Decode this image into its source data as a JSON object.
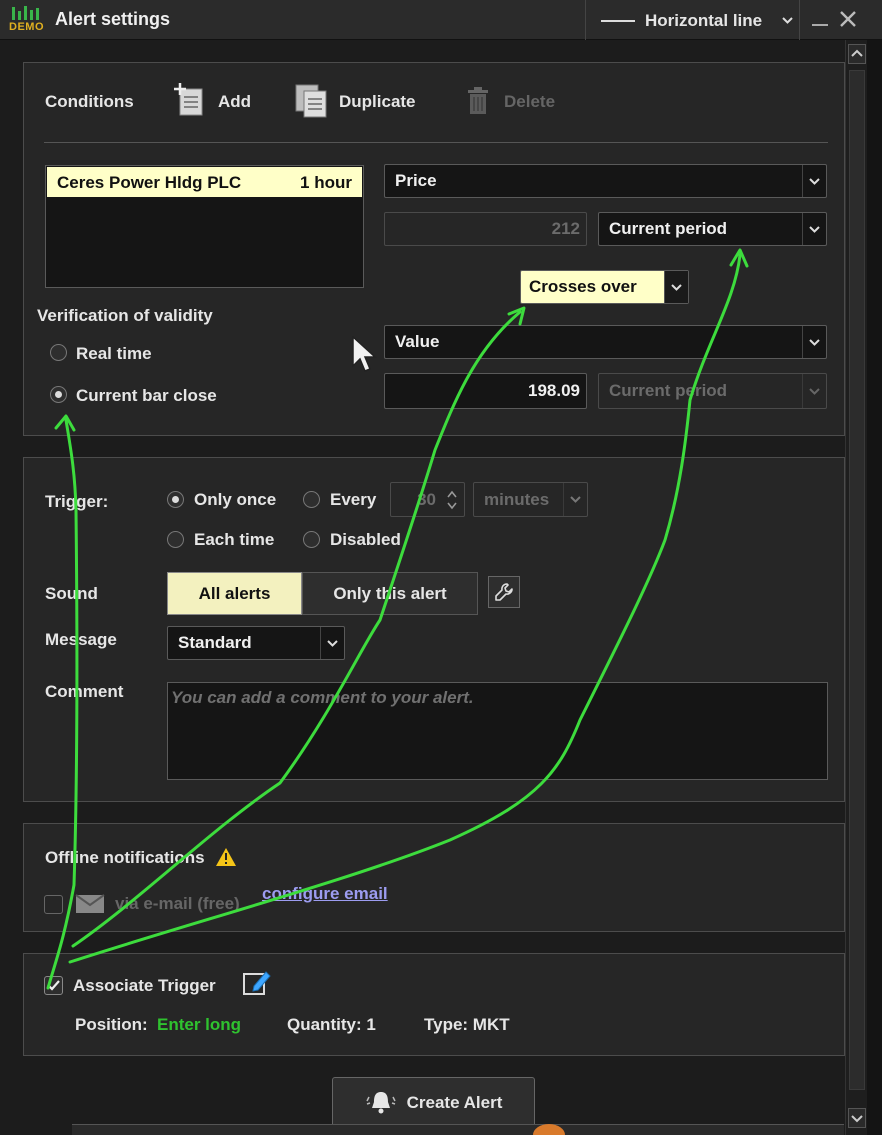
{
  "window": {
    "demo_badge": "DEMO",
    "title": "Alert settings",
    "drawing_tool": "Horizontal line"
  },
  "conditions": {
    "heading": "Conditions",
    "add_label": "Add",
    "duplicate_label": "Duplicate",
    "delete_label": "Delete",
    "list": [
      {
        "instrument": "Ceres Power Hldg PLC",
        "timeframe": "1 hour",
        "selected": true
      }
    ],
    "left_operand": {
      "source": "Price",
      "offset_value": "212",
      "period": "Current period"
    },
    "operator": "Crosses over",
    "right_operand": {
      "source": "Value",
      "value": "198.09",
      "period": "Current period"
    },
    "verification": {
      "heading": "Verification of validity",
      "options": [
        "Real time",
        "Current bar close"
      ],
      "selected": "Current bar close"
    }
  },
  "trigger": {
    "label": "Trigger:",
    "options": {
      "only_once": "Only once",
      "every": "Every",
      "each_time": "Each time",
      "disabled": "Disabled"
    },
    "selected": "Only once",
    "every_value": "30",
    "every_unit": "minutes",
    "sound_label": "Sound",
    "sound_all": "All alerts",
    "sound_this": "Only this alert",
    "sound_selected": "All alerts",
    "message_label": "Message",
    "message_value": "Standard",
    "comment_label": "Comment",
    "comment_placeholder": "You can add a comment to your alert."
  },
  "offline": {
    "heading": "Offline notifications",
    "email_label": "via e-mail (free)",
    "email_checked": false,
    "configure_link": "configure email"
  },
  "associate": {
    "label": "Associate Trigger",
    "checked": true,
    "position_label": "Position:",
    "position_value": "Enter long",
    "quantity": "Quantity: 1",
    "type": "Type: MKT"
  },
  "footer": {
    "create_label": "Create Alert"
  },
  "colors": {
    "highlight": "#ffffc8",
    "annotation": "#3ddc3d",
    "position_green": "#2fc22f",
    "link": "#9c9cf0",
    "warning": "#f5c518"
  }
}
